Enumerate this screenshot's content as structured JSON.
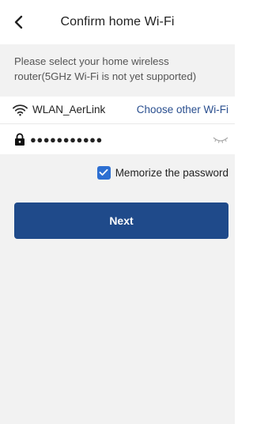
{
  "header": {
    "title": "Confirm home Wi-Fi",
    "back_icon": "chevron-left-icon"
  },
  "info": {
    "text": "Please select your home wireless router(5GHz Wi-Fi is not yet supported)"
  },
  "wifi": {
    "icon": "wifi-icon",
    "ssid": "WLAN_AerLink",
    "choose_other_label": "Choose other Wi-Fi"
  },
  "password": {
    "icon": "lock-icon",
    "value": "●●●●●●●●●●●",
    "visibility_icon": "eye-closed-icon"
  },
  "memorize": {
    "checked": true,
    "label": "Memorize the password"
  },
  "next_button": {
    "label": "Next"
  },
  "colors": {
    "accent": "#1f4a8a",
    "link": "#2a4f8f",
    "checkbox": "#2d6fd2",
    "background_gray": "#f2f2f2"
  }
}
